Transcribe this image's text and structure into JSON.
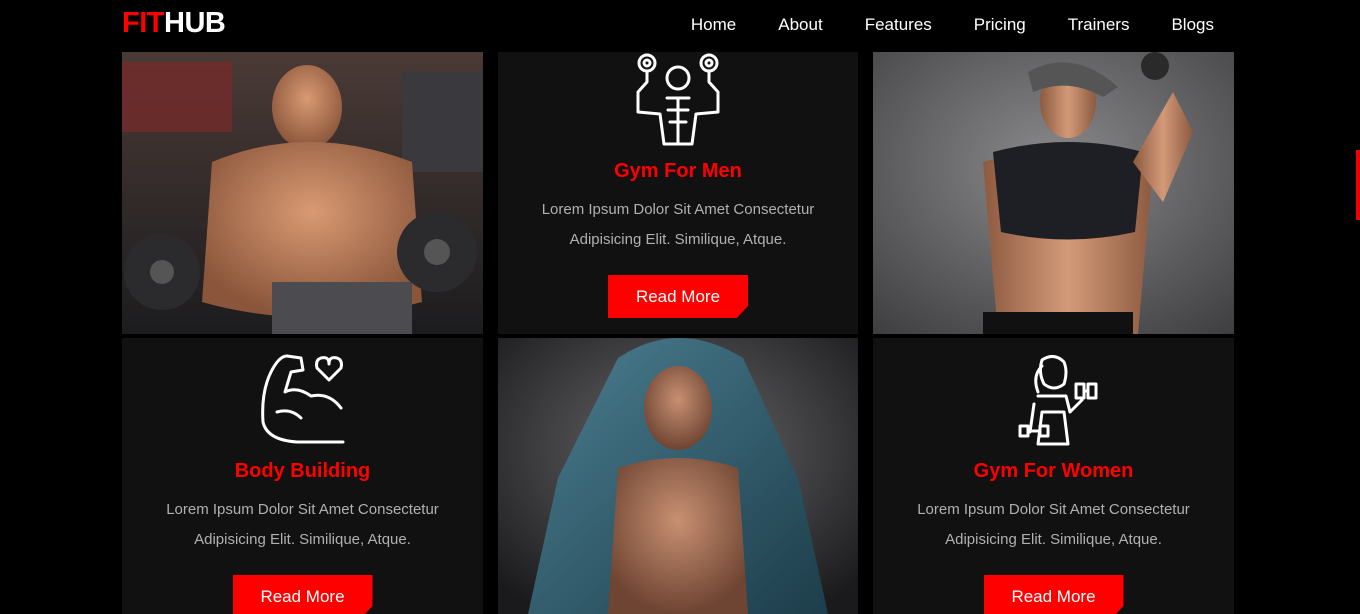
{
  "brand": {
    "part1": "FIT",
    "part2": "HUB"
  },
  "nav": [
    "Home",
    "About",
    "Features",
    "Pricing",
    "Trainers",
    "Blogs"
  ],
  "cards": [
    {
      "title": "Gym For Men",
      "text": "Lorem Ipsum Dolor Sit Amet Consectetur Adipisicing Elit. Similique, Atque.",
      "button": "Read More",
      "icon": "dumbbell-man-icon"
    },
    {
      "title": "Body Building",
      "text": "Lorem Ipsum Dolor Sit Amet Consectetur Adipisicing Elit. Similique, Atque.",
      "button": "Read More",
      "icon": "flexed-arm-heart-icon"
    },
    {
      "title": "Gym For Women",
      "text": "Lorem Ipsum Dolor Sit Amet Consectetur Adipisicing Elit. Similique, Atque.",
      "button": "Read More",
      "icon": "woman-dumbbell-icon"
    }
  ],
  "colors": {
    "accent": "#ff0000",
    "card_bg": "#111111",
    "page_bg": "#000000"
  }
}
